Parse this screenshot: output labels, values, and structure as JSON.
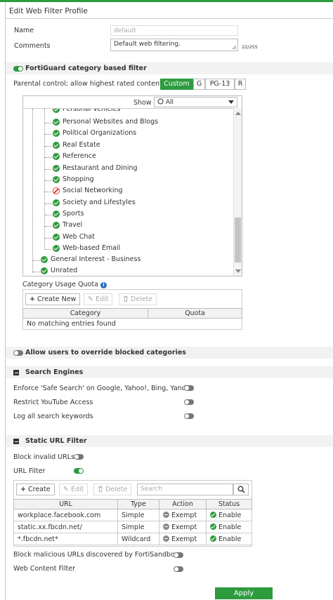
{
  "window": {
    "title": "Edit Web Filter Profile"
  },
  "form": {
    "name_label": "Name",
    "name_placeholder": "default",
    "comments_label": "Comments",
    "comments_value": "Default web filtering.",
    "comments_count": "22/255"
  },
  "fortiguard": {
    "title": "FortiGuard category based filter",
    "parental_label": "Parental control; allow highest rated content",
    "ratings": [
      "Custom",
      "G",
      "PG-13",
      "R"
    ],
    "active_rating": "Custom",
    "show_label": "Show",
    "show_value": "All",
    "categories_partial": "Personal Vehicles",
    "categories": [
      {
        "label": "Personal Websites and Blogs",
        "status": "allow"
      },
      {
        "label": "Political Organizations",
        "status": "allow"
      },
      {
        "label": "Real Estate",
        "status": "allow"
      },
      {
        "label": "Reference",
        "status": "allow"
      },
      {
        "label": "Restaurant and Dining",
        "status": "allow"
      },
      {
        "label": "Shopping",
        "status": "allow"
      },
      {
        "label": "Social Networking",
        "status": "block"
      },
      {
        "label": "Society and Lifestyles",
        "status": "allow"
      },
      {
        "label": "Sports",
        "status": "allow"
      },
      {
        "label": "Travel",
        "status": "allow"
      },
      {
        "label": "Web Chat",
        "status": "allow"
      },
      {
        "label": "Web-based Email",
        "status": "allow"
      }
    ],
    "groups": [
      {
        "label": "General Interest - Business",
        "status": "allow"
      },
      {
        "label": "Unrated",
        "status": "allow"
      }
    ]
  },
  "quota": {
    "title": "Category Usage Quota",
    "create_label": "Create New",
    "edit_label": "Edit",
    "delete_label": "Delete",
    "col_category": "Category",
    "col_quota": "Quota",
    "empty_text": "No matching entries found"
  },
  "override": {
    "title": "Allow users to override blocked categories"
  },
  "search_engines": {
    "title": "Search Engines",
    "safe_search": "Enforce 'Safe Search' on Google, Yahoo!, Bing, Yandex",
    "youtube": "Restrict YouTube Access",
    "log_keywords": "Log all search keywords"
  },
  "static_url": {
    "title": "Static URL Filter",
    "block_invalid": "Block invalid URLs",
    "url_filter": "URL Filter",
    "create_label": "Create",
    "edit_label": "Edit",
    "delete_label": "Delete",
    "search_placeholder": "Search",
    "columns": [
      "URL",
      "Type",
      "Action",
      "Status"
    ],
    "rows": [
      {
        "url": "workplace.facebook.com",
        "type": "Simple",
        "action": "Exempt",
        "status": "Enable"
      },
      {
        "url": "static.xx.fbcdn.net/",
        "type": "Simple",
        "action": "Exempt",
        "status": "Enable"
      },
      {
        "url": "*.fbcdn.net*",
        "type": "Wildcard",
        "action": "Exempt",
        "status": "Enable"
      }
    ],
    "block_malicious": "Block malicious URLs discovered by FortiSandbox",
    "web_content": "Web Content Filter"
  },
  "footer": {
    "apply_label": "Apply"
  },
  "colors": {
    "accent": "#2e9b3f",
    "block": "#e03a3a",
    "info": "#2a6fb8"
  },
  "icons": {
    "allow": "check-circle-icon",
    "block": "no-entry-icon",
    "create": "plus-icon",
    "edit": "pencil-icon",
    "delete": "trash-icon",
    "search": "magnifier-icon",
    "exempt": "minus-circle-icon"
  }
}
